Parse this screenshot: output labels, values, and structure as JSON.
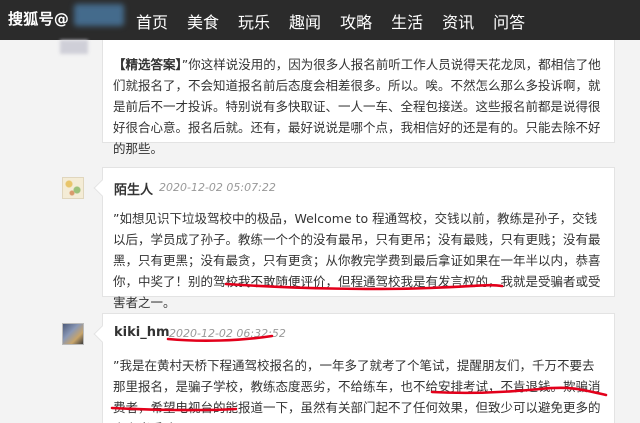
{
  "nav": {
    "brand": "搜狐号@",
    "brand_blurred": "何三侠",
    "items": [
      "首页",
      "美食",
      "玩乐",
      "趣闻",
      "攻略",
      "生活",
      "资讯",
      "问答"
    ]
  },
  "comments": [
    {
      "prefix": "【精选答案】",
      "text": "”你这样说没用的，因为很多人报名前听工作人员说得天花龙凤，都相信了他们就报名了，不会知道报名前后态度会相差很多。所以。唉。不然怎么那么多投诉啊，就是前后不一才投诉。特别说有多快取证、一人一车、全程包接送。这些报名前都是说得很好很合心意。报名后就。还有，最好说说是哪个点，我相信好的还是有的。只能去除不好的那些。"
    },
    {
      "user": "陌生人",
      "time": "2020-12-02 05:07:22",
      "text": "”如想见识下垃圾驾校中的极品，Welcome to 程通驾校，交钱以前，教练是孙子，交钱以后，学员成了孙子。教练一个个的没有最吊，只有更吊；没有最贱，只有更贱；没有最黑，只有更黑；没有最贪，只有更贪；从你教完学费到最后拿证如果在一年半以内，恭喜你，中奖了！别的驾校我不敢随便评价，但程通驾校我是有发言权的，我就是受骗者或受害者之一。"
    },
    {
      "user": "kiki_hm",
      "time": "2020-12-02 06:32:52",
      "text": "”我是在黄村天桥下程通驾校报名的，一年多了就考了个笔试，提醒朋友们，千万不要去那里报名，是骗子学校，教练态度恶劣，不给练车，也不给安排考试，不肯退钱。欺骗消费者，希望电视台的能报道一下，虽然有关部门起不了任何效果，但致少可以避免更多的人上当受骗。"
    }
  ],
  "colors": {
    "nav_bg": "#2b2b2b",
    "underline": "#e3001b"
  }
}
